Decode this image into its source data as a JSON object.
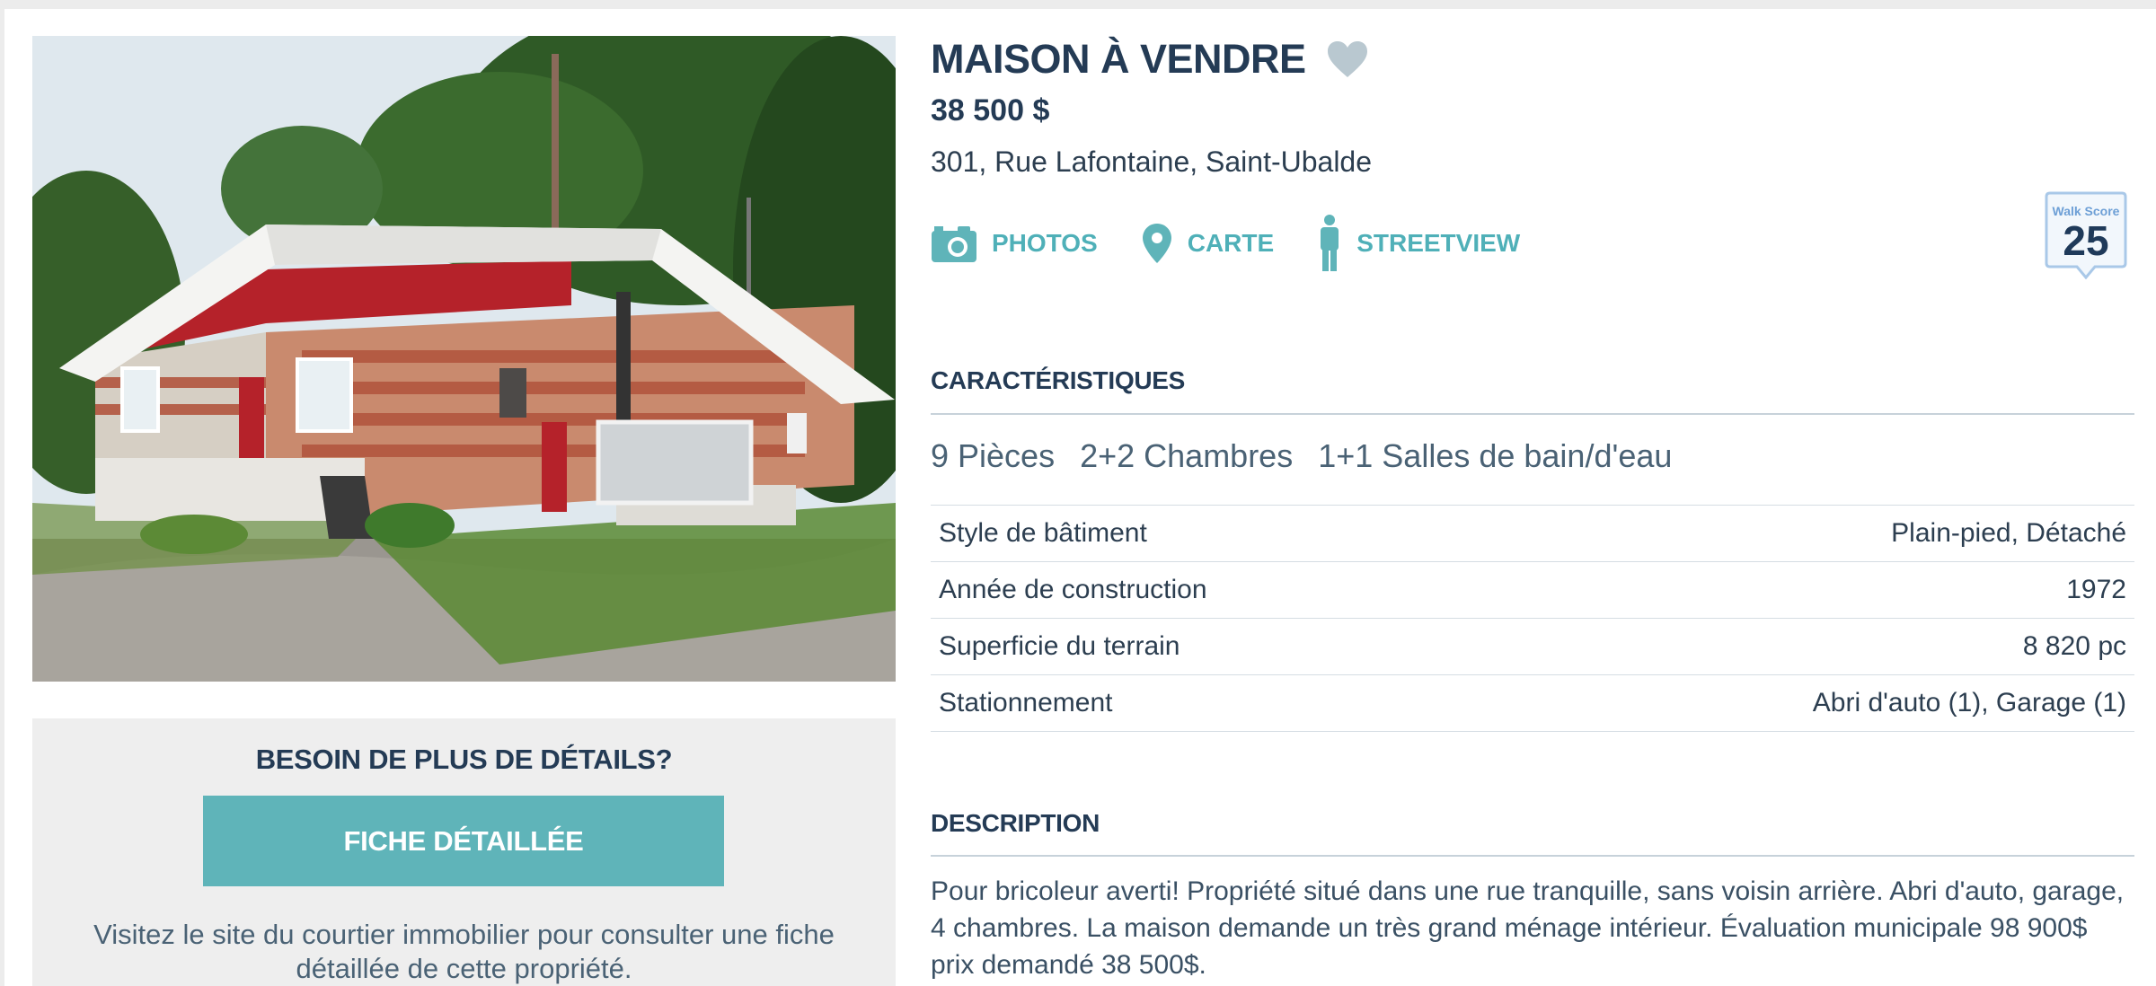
{
  "listing": {
    "title": "MAISON À VENDRE",
    "price": "38 500 $",
    "address": "301, Rue Lafontaine, Saint-Ubalde",
    "favorite_icon": "heart-icon"
  },
  "actions": [
    {
      "label": "PHOTOS",
      "icon": "camera-icon"
    },
    {
      "label": "CARTE",
      "icon": "map-pin-icon"
    },
    {
      "label": "STREETVIEW",
      "icon": "person-icon"
    }
  ],
  "walk_score": {
    "label": "Walk Score",
    "value": "25"
  },
  "features": {
    "heading": "CARACTÉRISTIQUES",
    "summary": [
      "9 Pièces",
      "2+2 Chambres",
      "1+1 Salles de bain/d'eau"
    ],
    "rows": [
      {
        "label": "Style de bâtiment",
        "value": "Plain-pied, Détaché"
      },
      {
        "label": "Année de construction",
        "value": "1972"
      },
      {
        "label": "Superficie du terrain",
        "value": "8 820 pc"
      },
      {
        "label": "Stationnement",
        "value": "Abri d'auto (1), Garage (1)"
      }
    ]
  },
  "description": {
    "heading": "DESCRIPTION",
    "text": "Pour bricoleur averti! Propriété situé dans une rue tranquille, sans voisin arrière. Abri d'auto, garage, 4 chambres. La maison demande un très grand ménage intérieur. Évaluation municipale 98 900$ prix demandé 38 500$."
  },
  "cta": {
    "title": "BESOIN DE PLUS DE DÉTAILS?",
    "button": "FICHE DÉTAILLÉE",
    "text": "Visitez le site du courtier immobilier pour consulter une fiche détaillée de cette propriété."
  },
  "colors": {
    "accent": "#5fb4b9",
    "heading": "#243b55",
    "roof_red": "#b5222a"
  }
}
